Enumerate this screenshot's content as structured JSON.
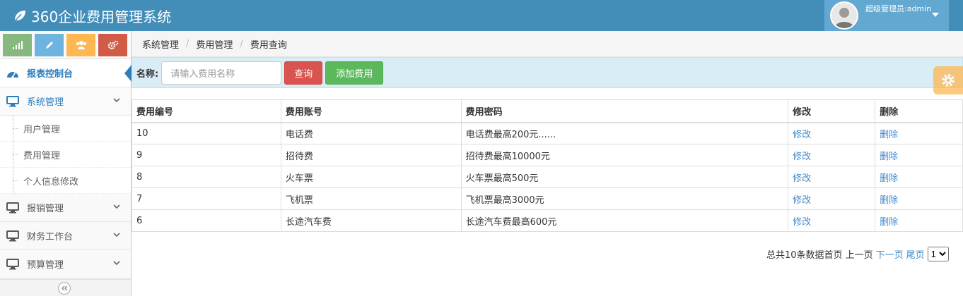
{
  "app": {
    "title": "360企业费用管理系统"
  },
  "user": {
    "name": "超级管理员:admin"
  },
  "sidebar": {
    "items": [
      {
        "label": "报表控制台"
      },
      {
        "label": "系统管理",
        "children": [
          {
            "label": "用户管理"
          },
          {
            "label": "费用管理"
          },
          {
            "label": "个人信息修改"
          }
        ]
      },
      {
        "label": "报销管理"
      },
      {
        "label": "财务工作台"
      },
      {
        "label": "预算管理"
      }
    ]
  },
  "breadcrumb": [
    "系统管理",
    "费用管理",
    "费用查询"
  ],
  "search": {
    "label": "名称:",
    "placeholder": "请输入费用名称",
    "query_button": "查询",
    "add_button": "添加费用"
  },
  "table": {
    "headers": [
      "费用编号",
      "费用账号",
      "费用密码",
      "修改",
      "删除"
    ],
    "rows": [
      [
        "10",
        "电话费",
        "电话费最高200元......",
        "修改",
        "删除"
      ],
      [
        "9",
        "招待费",
        "招待费最高10000元",
        "修改",
        "删除"
      ],
      [
        "8",
        "火车票",
        "火车票最高500元",
        "修改",
        "删除"
      ],
      [
        "7",
        "飞机票",
        "飞机票最高3000元",
        "修改",
        "删除"
      ],
      [
        "6",
        "长途汽车费",
        "长途汽车费最高600元",
        "修改",
        "删除"
      ]
    ]
  },
  "pager": {
    "summary": "总共10条数据",
    "first": "首页",
    "prev": "上一页",
    "next": "下一页",
    "last": "尾页",
    "page": "1"
  },
  "colors": {
    "header": "#438eb9",
    "link": "#428bca",
    "active": "#2b7dbc"
  }
}
